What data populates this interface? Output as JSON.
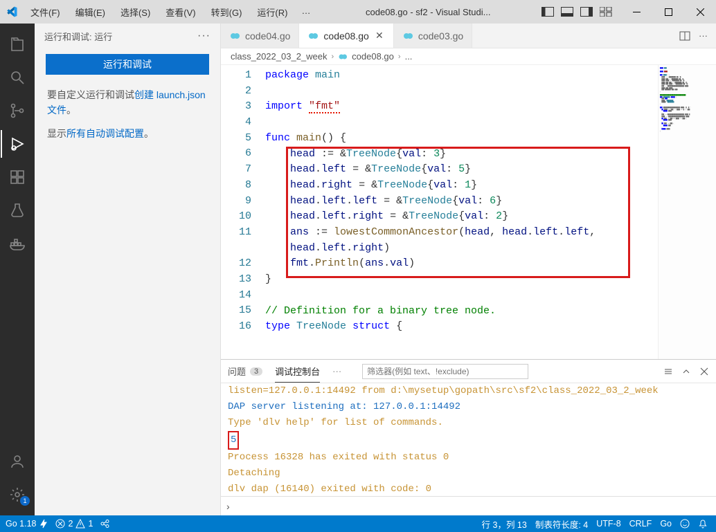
{
  "title": "code08.go - sf2 - Visual Studi...",
  "menu": {
    "file": "文件(F)",
    "edit": "编辑(E)",
    "select": "选择(S)",
    "view": "查看(V)",
    "go": "转到(G)",
    "run": "运行(R)",
    "ellipsis": "…"
  },
  "side": {
    "header": "运行和调试: 运行",
    "run_button": "运行和调试",
    "text1_before": "要自定义运行和调试",
    "text1_link": "创建 launch.json 文件",
    "text1_after": "。",
    "text2_before": "显示",
    "text2_link": "所有自动调试配置",
    "text2_after": "。"
  },
  "tabs": {
    "t1": "code04.go",
    "t2": "code08.go",
    "t3": "code03.go"
  },
  "breadcrumb": {
    "p1": "class_2022_03_2_week",
    "p2": "code08.go",
    "ellipsis": "..."
  },
  "code": {
    "line_start": 1,
    "line_end": 16,
    "l1_kw": "package",
    "l1_id": "main",
    "l3_kw": "import",
    "l3_str": "\"fmt\"",
    "l5_kw": "func",
    "l5_fn": "main",
    "l6": "head := &TreeNode{val: 3}",
    "l6_type": "TreeNode",
    "l6_prop": "val",
    "l6_num": "3",
    "l7_type": "TreeNode",
    "l7_prop": "val",
    "l7_num": "5",
    "l8_type": "TreeNode",
    "l8_prop": "val",
    "l8_num": "1",
    "l9_type": "TreeNode",
    "l9_prop": "val",
    "l9_num": "6",
    "l10_type": "TreeNode",
    "l10_prop": "val",
    "l10_num": "2",
    "l11_fn": "lowestCommonAncestor",
    "l12_obj": "fmt",
    "l12_fn": "Println",
    "l15_comment": "// Definition for a binary tree node.",
    "l16_kw": "type",
    "l16_type": "TreeNode",
    "l16_kw2": "struct"
  },
  "panel": {
    "tab_problems": "问题",
    "tab_problems_count": "3",
    "tab_debug": "调试控制台",
    "filter_placeholder": "筛选器(例如 text、!exclude)",
    "outputs": [
      "listen=127.0.0.1:14492 from d:\\mysetup\\gopath\\src\\sf2\\class_2022_03_2_week",
      "DAP server listening at: 127.0.0.1:14492",
      "Type 'dlv help' for list of commands.",
      "5",
      "Process 16328 has exited with status 0",
      "Detaching",
      "dlv dap (16140) exited with code: 0"
    ]
  },
  "status": {
    "go": "Go 1.18",
    "errors": "2",
    "warnings": "1",
    "line_col": "行 3，列 13",
    "tab_size": "制表符长度: 4",
    "encoding": "UTF-8",
    "eol": "CRLF",
    "lang": "Go"
  },
  "activity_badge": "1"
}
